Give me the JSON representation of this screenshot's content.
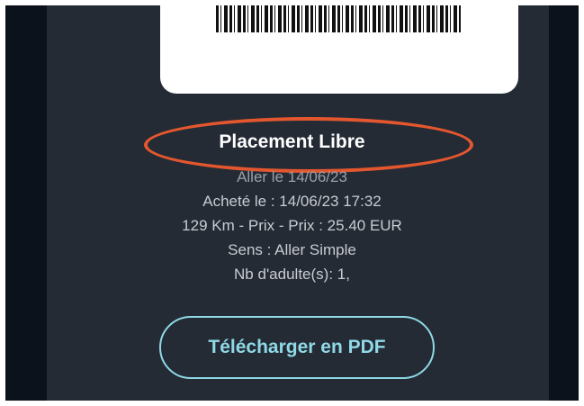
{
  "ticket": {
    "title": "Placement Libre",
    "details": [
      "Aller le 14/06/23",
      "Acheté le : 14/06/23 17:32",
      "129 Km - Prix - Prix : 25.40 EUR",
      "Sens : Aller Simple",
      "Nb d'adulte(s): 1,"
    ]
  },
  "actions": {
    "download_pdf_label": "Télécharger en PDF"
  },
  "annotation": {
    "highlight_color": "#e4572e"
  },
  "colors": {
    "background": "#242b35",
    "accent": "#8fd9e6"
  }
}
